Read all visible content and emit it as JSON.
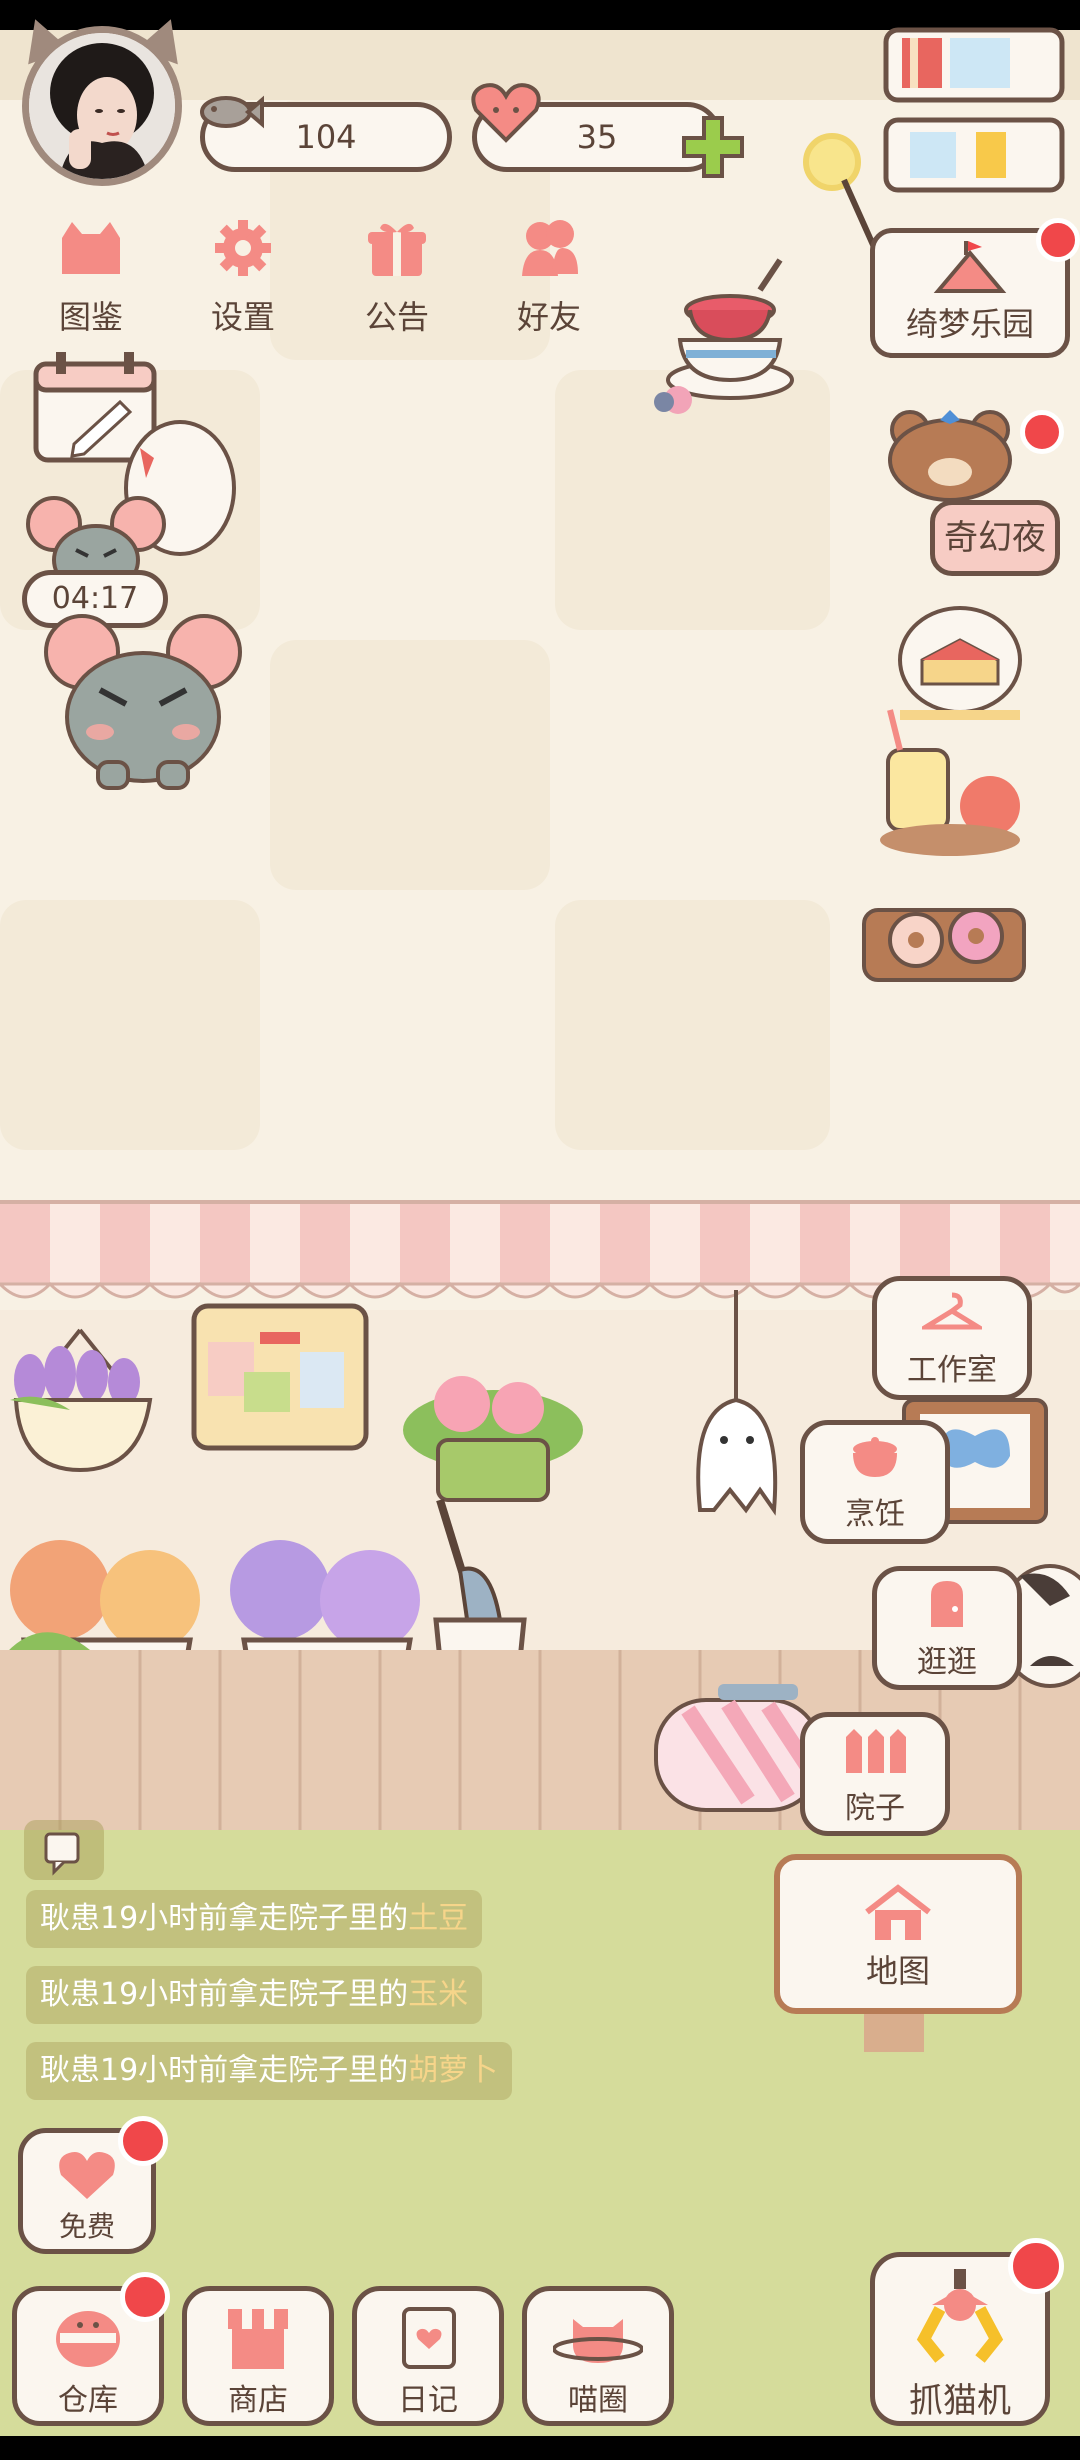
{
  "stats": {
    "fish": "104",
    "hearts": "35"
  },
  "top_menu": [
    {
      "label": "图鉴",
      "icon": "cat-book-icon"
    },
    {
      "label": "设置",
      "icon": "gear-icon"
    },
    {
      "label": "公告",
      "icon": "gift-icon"
    },
    {
      "label": "好友",
      "icon": "friends-icon"
    }
  ],
  "events": {
    "park": "绮梦乐园",
    "night": "奇幻夜"
  },
  "timer": "04:17",
  "rooms": [
    {
      "label": "工作室",
      "icon": "hanger-icon"
    },
    {
      "label": "烹饪",
      "icon": "pot-icon"
    },
    {
      "label": "逛逛",
      "icon": "door-icon"
    },
    {
      "label": "院子",
      "icon": "fence-icon"
    }
  ],
  "map": {
    "label": "地图",
    "icon": "house-icon"
  },
  "messages": [
    {
      "prefix": "耿患19小时前拿走院子里的",
      "item": "土豆"
    },
    {
      "prefix": "耿患19小时前拿走院子里的",
      "item": "玉米"
    },
    {
      "prefix": "耿患19小时前拿走院子里的",
      "item": "胡萝卜"
    }
  ],
  "free": {
    "label": "免费"
  },
  "bottom_nav": [
    {
      "label": "仓库",
      "icon": "storage-icon"
    },
    {
      "label": "商店",
      "icon": "shop-icon"
    },
    {
      "label": "日记",
      "icon": "diary-icon"
    },
    {
      "label": "喵圈",
      "icon": "cat-planet-icon"
    }
  ],
  "claw": {
    "label": "抓猫机",
    "icon": "claw-icon"
  },
  "colors": {
    "accent_red": "#f0474a",
    "pink": "#f48b85",
    "outline": "#6b5246",
    "highlight_text": "#f6d58a"
  }
}
